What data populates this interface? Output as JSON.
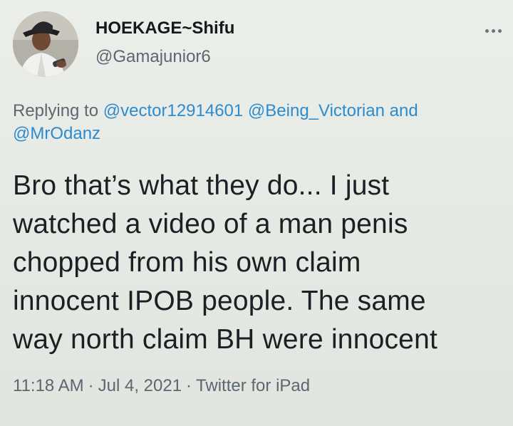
{
  "user": {
    "display_name": "HOEKAGE~Shifu",
    "handle": "@Gamajunior6",
    "avatar_icon": "profile-photo-man-in-hat"
  },
  "reply": {
    "prefix": "Replying to ",
    "mention_1": "@vector12914601",
    "mention_2": "@Being_Victorian",
    "conjunction": " and",
    "mention_3": "@MrOdanz"
  },
  "tweet": {
    "lines": [
      "Bro that’s what they do... I just",
      "watched a video of a man penis",
      "chopped from his own claim",
      "innocent IPOB people. The same",
      "way north claim BH were innocent"
    ]
  },
  "meta": {
    "time": "11:18 AM",
    "date": "Jul 4, 2021",
    "source": "Twitter for iPad",
    "separator": "·"
  },
  "colors": {
    "background": "#e8e9e6",
    "text": "#1c1f23",
    "secondary": "#5c6770",
    "link": "#2b8ccf"
  }
}
